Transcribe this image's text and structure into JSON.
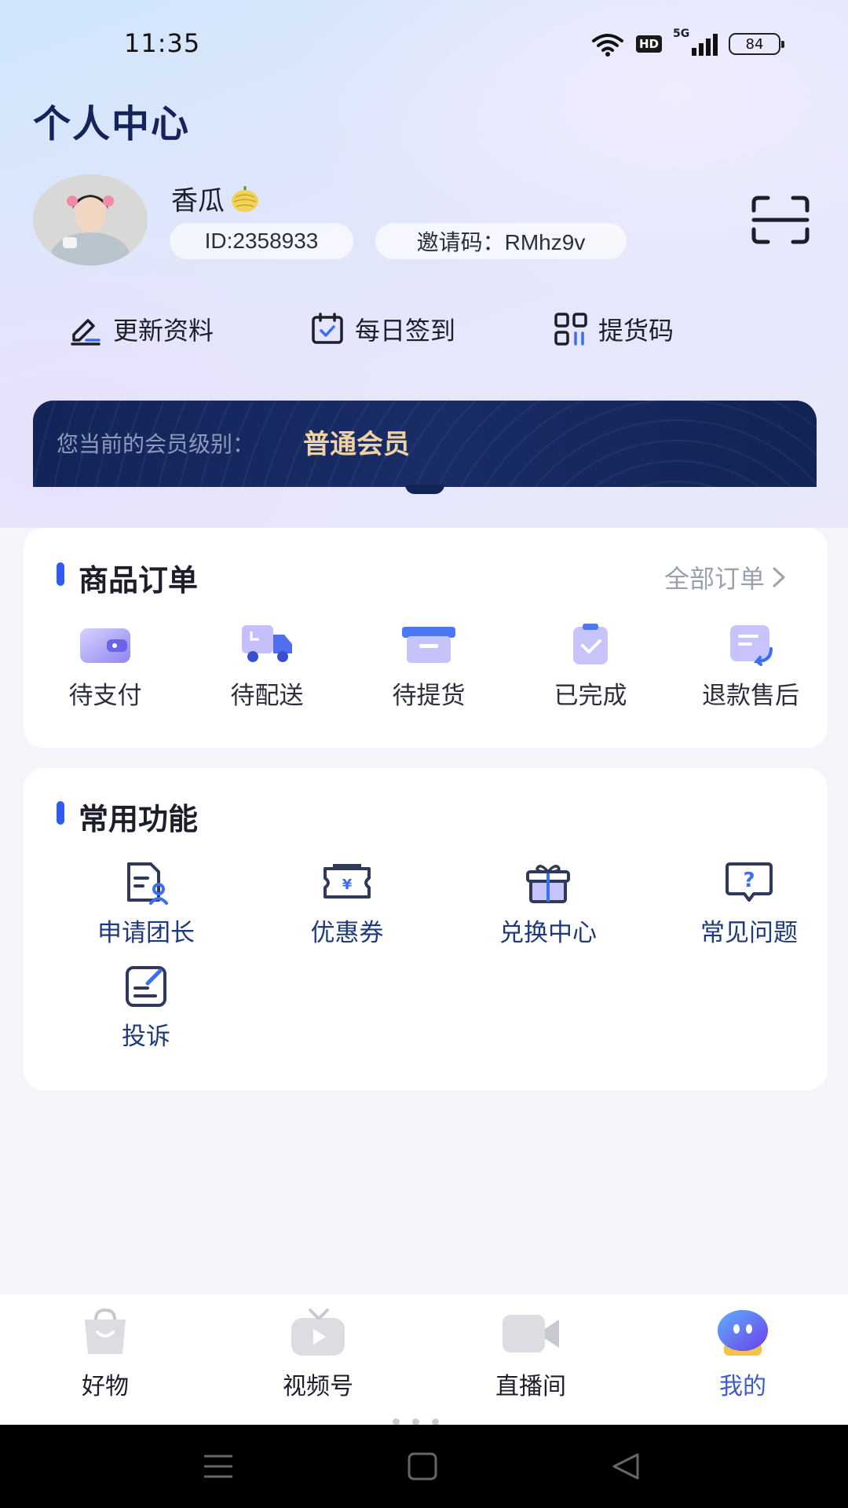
{
  "status_bar": {
    "time": "11:35",
    "hd": "HD",
    "network": "5G",
    "battery": "84"
  },
  "header": {
    "title": "个人中心"
  },
  "profile": {
    "name": "香瓜",
    "id_text": "ID:2358933",
    "invite_text": "邀请码：RMhz9v"
  },
  "quick_actions": [
    {
      "label": "更新资料",
      "icon": "edit-icon"
    },
    {
      "label": "每日签到",
      "icon": "calendar-check-icon"
    },
    {
      "label": "提货码",
      "icon": "qrcode-icon"
    }
  ],
  "member": {
    "label": "您当前的会员级别：",
    "level": "普通会员"
  },
  "orders": {
    "title": "商品订单",
    "all_link": "全部订单",
    "items": [
      {
        "label": "待支付",
        "icon": "wallet-icon"
      },
      {
        "label": "待配送",
        "icon": "truck-icon"
      },
      {
        "label": "待提货",
        "icon": "box-icon"
      },
      {
        "label": "已完成",
        "icon": "clipboard-check-icon"
      },
      {
        "label": "退款售后",
        "icon": "refund-icon"
      }
    ]
  },
  "functions": {
    "title": "常用功能",
    "items": [
      {
        "label": "申请团长",
        "icon": "apply-leader-icon"
      },
      {
        "label": "优惠券",
        "icon": "coupon-icon"
      },
      {
        "label": "兑换中心",
        "icon": "gift-icon"
      },
      {
        "label": "常见问题",
        "icon": "faq-icon"
      },
      {
        "label": "投诉",
        "icon": "complaint-icon"
      }
    ]
  },
  "tabbar": [
    {
      "label": "好物",
      "icon": "shopping-bag-icon",
      "active": false
    },
    {
      "label": "视频号",
      "icon": "tv-icon",
      "active": false
    },
    {
      "label": "直播间",
      "icon": "video-camera-icon",
      "active": false
    },
    {
      "label": "我的",
      "icon": "mascot-icon",
      "active": true
    }
  ],
  "colors": {
    "accent": "#2f5bf2",
    "active_tab": "#3b5bdb",
    "banner": "#132459",
    "member_gold": "#f0d3a2"
  }
}
